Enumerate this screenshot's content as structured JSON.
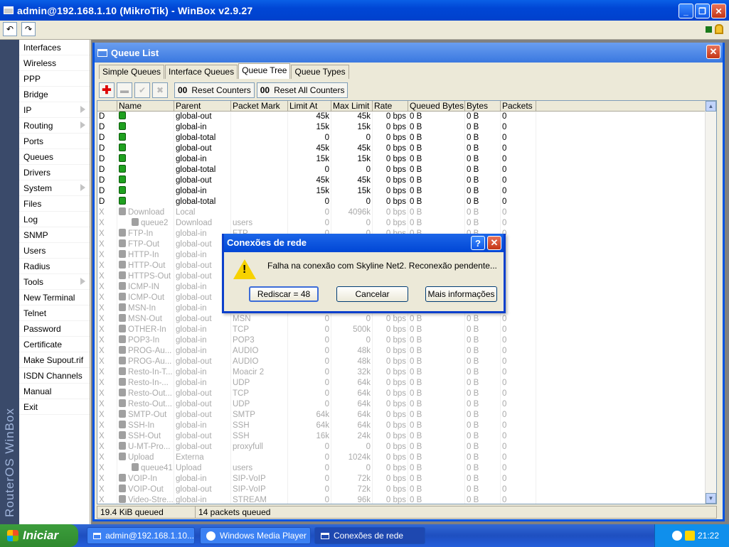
{
  "window": {
    "title": "admin@192.168.1.10 (MikroTik) - WinBox v2.9.27"
  },
  "toolbar": {
    "undo": "↶",
    "redo": "↷"
  },
  "sidebar": {
    "brand": "RouterOS WinBox",
    "items": [
      {
        "label": "Interfaces",
        "arrow": false
      },
      {
        "label": "Wireless",
        "arrow": false
      },
      {
        "label": "PPP",
        "arrow": false
      },
      {
        "label": "Bridge",
        "arrow": false
      },
      {
        "label": "IP",
        "arrow": true
      },
      {
        "label": "Routing",
        "arrow": true
      },
      {
        "label": "Ports",
        "arrow": false
      },
      {
        "label": "Queues",
        "arrow": false
      },
      {
        "label": "Drivers",
        "arrow": false
      },
      {
        "label": "System",
        "arrow": true
      },
      {
        "label": "Files",
        "arrow": false
      },
      {
        "label": "Log",
        "arrow": false
      },
      {
        "label": "SNMP",
        "arrow": false
      },
      {
        "label": "Users",
        "arrow": false
      },
      {
        "label": "Radius",
        "arrow": false
      },
      {
        "label": "Tools",
        "arrow": true
      },
      {
        "label": "New Terminal",
        "arrow": false
      },
      {
        "label": "Telnet",
        "arrow": false
      },
      {
        "label": "Password",
        "arrow": false
      },
      {
        "label": "Certificate",
        "arrow": false
      },
      {
        "label": "Make Supout.rif",
        "arrow": false
      },
      {
        "label": "ISDN Channels",
        "arrow": false
      },
      {
        "label": "Manual",
        "arrow": false
      },
      {
        "label": "Exit",
        "arrow": false
      }
    ]
  },
  "queue_window": {
    "title": "Queue List",
    "tabs": [
      "Simple Queues",
      "Interface Queues",
      "Queue Tree",
      "Queue Types"
    ],
    "active_tab": "Queue Tree",
    "reset_counters": "Reset Counters",
    "reset_all_counters": "Reset All Counters",
    "counter_icon": "00",
    "columns": [
      "",
      "Name",
      "Parent",
      "Packet Mark",
      "Limit At",
      "Max Limit",
      "Rate",
      "Queued Bytes",
      "Bytes",
      "Packets"
    ],
    "rows": [
      {
        "flag": "D",
        "name": "",
        "parent": "global-out",
        "mark": "",
        "limit": "45k",
        "max": "45k",
        "rate": "0 bps",
        "queued": "0 B",
        "bytes": "0 B",
        "packets": "0",
        "dyn": true,
        "indent": false
      },
      {
        "flag": "D",
        "name": "",
        "parent": "global-in",
        "mark": "",
        "limit": "15k",
        "max": "15k",
        "rate": "0 bps",
        "queued": "0 B",
        "bytes": "0 B",
        "packets": "0",
        "dyn": true,
        "indent": false
      },
      {
        "flag": "D",
        "name": "",
        "parent": "global-total",
        "mark": "",
        "limit": "0",
        "max": "0",
        "rate": "0 bps",
        "queued": "0 B",
        "bytes": "0 B",
        "packets": "0",
        "dyn": true,
        "indent": false
      },
      {
        "flag": "D",
        "name": "",
        "parent": "global-out",
        "mark": "",
        "limit": "45k",
        "max": "45k",
        "rate": "0 bps",
        "queued": "0 B",
        "bytes": "0 B",
        "packets": "0",
        "dyn": true,
        "indent": false
      },
      {
        "flag": "D",
        "name": "",
        "parent": "global-in",
        "mark": "",
        "limit": "15k",
        "max": "15k",
        "rate": "0 bps",
        "queued": "0 B",
        "bytes": "0 B",
        "packets": "0",
        "dyn": true,
        "indent": false
      },
      {
        "flag": "D",
        "name": "",
        "parent": "global-total",
        "mark": "",
        "limit": "0",
        "max": "0",
        "rate": "0 bps",
        "queued": "0 B",
        "bytes": "0 B",
        "packets": "0",
        "dyn": true,
        "indent": false
      },
      {
        "flag": "D",
        "name": "",
        "parent": "global-out",
        "mark": "",
        "limit": "45k",
        "max": "45k",
        "rate": "0 bps",
        "queued": "0 B",
        "bytes": "0 B",
        "packets": "0",
        "dyn": true,
        "indent": false
      },
      {
        "flag": "D",
        "name": "",
        "parent": "global-in",
        "mark": "",
        "limit": "15k",
        "max": "15k",
        "rate": "0 bps",
        "queued": "0 B",
        "bytes": "0 B",
        "packets": "0",
        "dyn": true,
        "indent": false
      },
      {
        "flag": "D",
        "name": "",
        "parent": "global-total",
        "mark": "",
        "limit": "0",
        "max": "0",
        "rate": "0 bps",
        "queued": "0 B",
        "bytes": "0 B",
        "packets": "0",
        "dyn": true,
        "indent": false
      },
      {
        "flag": "X",
        "name": "Download",
        "parent": "Local",
        "mark": "",
        "limit": "0",
        "max": "4096k",
        "rate": "0 bps",
        "queued": "0 B",
        "bytes": "0 B",
        "packets": "0",
        "dyn": false,
        "indent": false
      },
      {
        "flag": "X",
        "name": "queue2",
        "parent": "Download",
        "mark": "users",
        "limit": "0",
        "max": "0",
        "rate": "0 bps",
        "queued": "0 B",
        "bytes": "0 B",
        "packets": "0",
        "dyn": false,
        "indent": true
      },
      {
        "flag": "X",
        "name": "FTP-In",
        "parent": "global-in",
        "mark": "FTP",
        "limit": "0",
        "max": "0",
        "rate": "0 bps",
        "queued": "0 B",
        "bytes": "0 B",
        "packets": "0",
        "dyn": false,
        "indent": false
      },
      {
        "flag": "X",
        "name": "FTP-Out",
        "parent": "global-out",
        "mark": "",
        "limit": "",
        "max": "",
        "rate": "",
        "queued": "",
        "bytes": "",
        "packets": "",
        "dyn": false,
        "indent": false
      },
      {
        "flag": "X",
        "name": "HTTP-In",
        "parent": "global-in",
        "mark": "",
        "limit": "",
        "max": "",
        "rate": "",
        "queued": "",
        "bytes": "",
        "packets": "",
        "dyn": false,
        "indent": false
      },
      {
        "flag": "X",
        "name": "HTTP-Out",
        "parent": "global-out",
        "mark": "",
        "limit": "",
        "max": "",
        "rate": "",
        "queued": "",
        "bytes": "",
        "packets": "",
        "dyn": false,
        "indent": false
      },
      {
        "flag": "X",
        "name": "HTTPS-Out",
        "parent": "global-out",
        "mark": "",
        "limit": "",
        "max": "",
        "rate": "",
        "queued": "",
        "bytes": "",
        "packets": "",
        "dyn": false,
        "indent": false
      },
      {
        "flag": "X",
        "name": "ICMP-IN",
        "parent": "global-in",
        "mark": "",
        "limit": "",
        "max": "",
        "rate": "",
        "queued": "",
        "bytes": "",
        "packets": "",
        "dyn": false,
        "indent": false
      },
      {
        "flag": "X",
        "name": "ICMP-Out",
        "parent": "global-out",
        "mark": "",
        "limit": "",
        "max": "",
        "rate": "",
        "queued": "",
        "bytes": "",
        "packets": "",
        "dyn": false,
        "indent": false
      },
      {
        "flag": "X",
        "name": "MSN-In",
        "parent": "global-in",
        "mark": "",
        "limit": "",
        "max": "",
        "rate": "",
        "queued": "",
        "bytes": "",
        "packets": "",
        "dyn": false,
        "indent": false
      },
      {
        "flag": "X",
        "name": "MSN-Out",
        "parent": "global-out",
        "mark": "MSN",
        "limit": "0",
        "max": "0",
        "rate": "0 bps",
        "queued": "0 B",
        "bytes": "0 B",
        "packets": "0",
        "dyn": false,
        "indent": false
      },
      {
        "flag": "X",
        "name": "OTHER-In",
        "parent": "global-in",
        "mark": "TCP",
        "limit": "0",
        "max": "500k",
        "rate": "0 bps",
        "queued": "0 B",
        "bytes": "0 B",
        "packets": "0",
        "dyn": false,
        "indent": false
      },
      {
        "flag": "X",
        "name": "POP3-In",
        "parent": "global-in",
        "mark": "POP3",
        "limit": "0",
        "max": "0",
        "rate": "0 bps",
        "queued": "0 B",
        "bytes": "0 B",
        "packets": "0",
        "dyn": false,
        "indent": false
      },
      {
        "flag": "X",
        "name": "PROG-Au...",
        "parent": "global-in",
        "mark": "AUDIO",
        "limit": "0",
        "max": "48k",
        "rate": "0 bps",
        "queued": "0 B",
        "bytes": "0 B",
        "packets": "0",
        "dyn": false,
        "indent": false
      },
      {
        "flag": "X",
        "name": "PROG-Au...",
        "parent": "global-out",
        "mark": "AUDIO",
        "limit": "0",
        "max": "48k",
        "rate": "0 bps",
        "queued": "0 B",
        "bytes": "0 B",
        "packets": "0",
        "dyn": false,
        "indent": false
      },
      {
        "flag": "X",
        "name": "Resto-In-T...",
        "parent": "global-in",
        "mark": "Moacir 2",
        "limit": "0",
        "max": "32k",
        "rate": "0 bps",
        "queued": "0 B",
        "bytes": "0 B",
        "packets": "0",
        "dyn": false,
        "indent": false
      },
      {
        "flag": "X",
        "name": "Resto-In-...",
        "parent": "global-in",
        "mark": "UDP",
        "limit": "0",
        "max": "64k",
        "rate": "0 bps",
        "queued": "0 B",
        "bytes": "0 B",
        "packets": "0",
        "dyn": false,
        "indent": false
      },
      {
        "flag": "X",
        "name": "Resto-Out...",
        "parent": "global-out",
        "mark": "TCP",
        "limit": "0",
        "max": "64k",
        "rate": "0 bps",
        "queued": "0 B",
        "bytes": "0 B",
        "packets": "0",
        "dyn": false,
        "indent": false
      },
      {
        "flag": "X",
        "name": "Resto-Out...",
        "parent": "global-out",
        "mark": "UDP",
        "limit": "0",
        "max": "64k",
        "rate": "0 bps",
        "queued": "0 B",
        "bytes": "0 B",
        "packets": "0",
        "dyn": false,
        "indent": false
      },
      {
        "flag": "X",
        "name": "SMTP-Out",
        "parent": "global-out",
        "mark": "SMTP",
        "limit": "64k",
        "max": "64k",
        "rate": "0 bps",
        "queued": "0 B",
        "bytes": "0 B",
        "packets": "0",
        "dyn": false,
        "indent": false
      },
      {
        "flag": "X",
        "name": "SSH-In",
        "parent": "global-in",
        "mark": "SSH",
        "limit": "64k",
        "max": "64k",
        "rate": "0 bps",
        "queued": "0 B",
        "bytes": "0 B",
        "packets": "0",
        "dyn": false,
        "indent": false
      },
      {
        "flag": "X",
        "name": "SSH-Out",
        "parent": "global-out",
        "mark": "SSH",
        "limit": "16k",
        "max": "24k",
        "rate": "0 bps",
        "queued": "0 B",
        "bytes": "0 B",
        "packets": "0",
        "dyn": false,
        "indent": false
      },
      {
        "flag": "X",
        "name": "U-MT-Pro...",
        "parent": "global-out",
        "mark": "proxyfull",
        "limit": "0",
        "max": "0",
        "rate": "0 bps",
        "queued": "0 B",
        "bytes": "0 B",
        "packets": "0",
        "dyn": false,
        "indent": false
      },
      {
        "flag": "X",
        "name": "Upload",
        "parent": "Externa",
        "mark": "",
        "limit": "0",
        "max": "1024k",
        "rate": "0 bps",
        "queued": "0 B",
        "bytes": "0 B",
        "packets": "0",
        "dyn": false,
        "indent": false
      },
      {
        "flag": "X",
        "name": "queue41",
        "parent": "Upload",
        "mark": "users",
        "limit": "0",
        "max": "0",
        "rate": "0 bps",
        "queued": "0 B",
        "bytes": "0 B",
        "packets": "0",
        "dyn": false,
        "indent": true
      },
      {
        "flag": "X",
        "name": "VOIP-In",
        "parent": "global-in",
        "mark": "SIP-VoIP",
        "limit": "0",
        "max": "72k",
        "rate": "0 bps",
        "queued": "0 B",
        "bytes": "0 B",
        "packets": "0",
        "dyn": false,
        "indent": false
      },
      {
        "flag": "X",
        "name": "VOIP-Out",
        "parent": "global-out",
        "mark": "SIP-VoIP",
        "limit": "0",
        "max": "72k",
        "rate": "0 bps",
        "queued": "0 B",
        "bytes": "0 B",
        "packets": "0",
        "dyn": false,
        "indent": false
      },
      {
        "flag": "X",
        "name": "Video-Stre...",
        "parent": "global-in",
        "mark": "STREAM",
        "limit": "0",
        "max": "96k",
        "rate": "0 bps",
        "queued": "0 B",
        "bytes": "0 B",
        "packets": "0",
        "dyn": false,
        "indent": false
      }
    ],
    "status": {
      "queued": "19.4 KiB queued",
      "packets": "14 packets queued"
    }
  },
  "dialog": {
    "title": "Conexões de rede",
    "message": "Falha na conexão com Skyline Net2. Reconexão pendente...",
    "redial": "Rediscar = 48",
    "cancel": "Cancelar",
    "more": "Mais informações",
    "help": "?",
    "close": "✕"
  },
  "taskbar": {
    "start": "Iniciar",
    "tasks": [
      "admin@192.168.1.10...",
      "Windows Media Player",
      "Conexões de rede"
    ],
    "clock": "21:22"
  },
  "colors": {
    "xp_blue": "#0054e3",
    "start_green": "#2f8a2f",
    "queue_green": "#1fa01f"
  }
}
